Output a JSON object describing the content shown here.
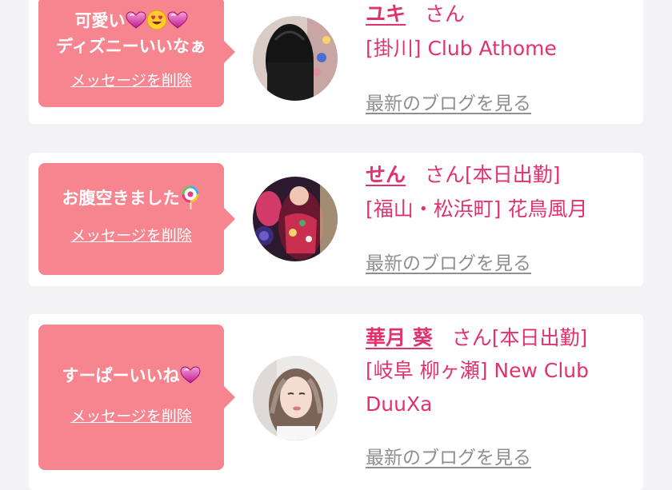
{
  "entries": [
    {
      "message_line1": "可愛い",
      "message_line2": "ディズニーいいなぁ",
      "delete_label": "メッセージを削除",
      "name": "ユキ",
      "suffix": "さん",
      "shop": "[掛川] Club Athome",
      "blog_label": "最新のブログを見る",
      "message_icons": [
        "heart-icon",
        "heart-eyes-icon",
        "heart-icon"
      ]
    },
    {
      "message": "お腹空きました",
      "delete_label": "メッセージを削除",
      "name": "せん",
      "suffix": "さん[本日出勤]",
      "shop": "[福山・松浜町] 花鳥風月",
      "blog_label": "最新のブログを見る",
      "message_icons": [
        "lollipop-icon"
      ]
    },
    {
      "message": "すーぱーいいね",
      "delete_label": "メッセージを削除",
      "name": "華月 葵",
      "suffix": "さん[本日出勤]",
      "shop_line1": "[岐阜 柳ヶ瀬] New Club",
      "shop_line2": "DuuXa",
      "blog_label": "最新のブログを見る",
      "message_icons": [
        "heart-icon"
      ]
    }
  ],
  "colors": {
    "bubble": "#f7858f",
    "accent": "#e1336b",
    "blog_link": "#8f8f8f",
    "background": "#f3f3f5"
  }
}
